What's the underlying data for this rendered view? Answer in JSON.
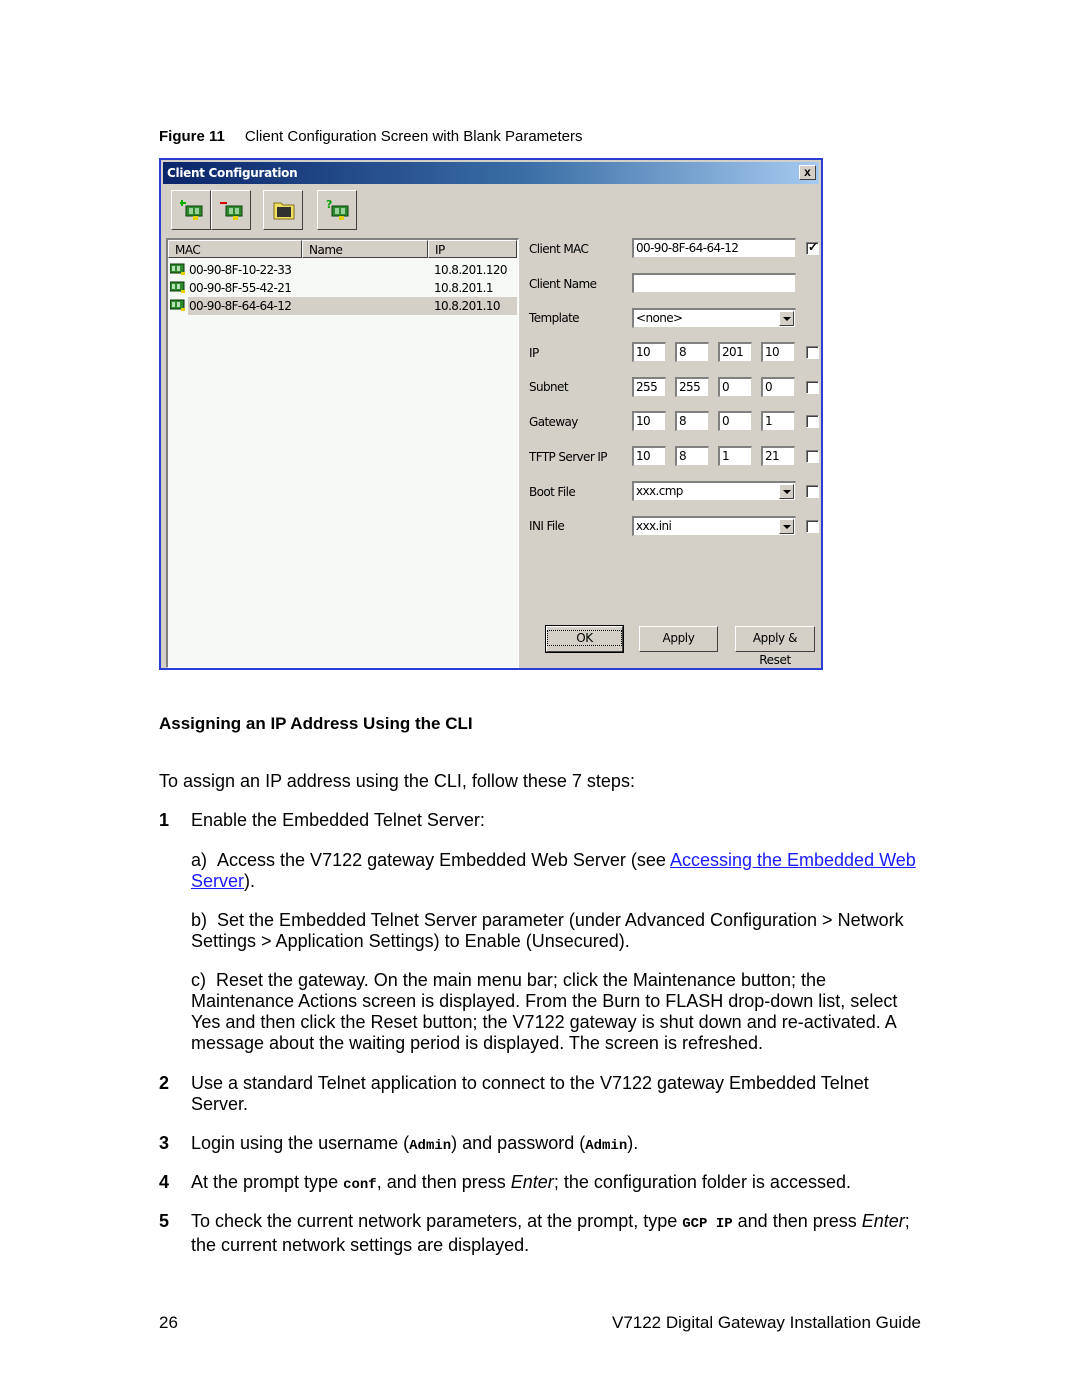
{
  "figure": {
    "label": "Figure 11",
    "caption": "Client Configuration Screen with Blank Parameters"
  },
  "window": {
    "title": "Client Configuration",
    "close_label": "x",
    "toolbar": [
      {
        "icon": "add-client-icon",
        "tooltip": ""
      },
      {
        "icon": "remove-client-icon",
        "tooltip": ""
      },
      {
        "icon": "folder-icon",
        "tooltip": ""
      },
      {
        "icon": "query-client-icon",
        "tooltip": ""
      }
    ],
    "list": {
      "columns": [
        "MAC",
        "Name",
        "IP"
      ],
      "rows": [
        {
          "mac": "00-90-8F-10-22-33",
          "name": "",
          "ip": "10.8.201.120",
          "selected": false
        },
        {
          "mac": "00-90-8F-55-42-21",
          "name": "",
          "ip": "10.8.201.1",
          "selected": false
        },
        {
          "mac": "00-90-8F-64-64-12",
          "name": "",
          "ip": "10.8.201.10",
          "selected": true
        }
      ]
    },
    "form": {
      "client_mac": {
        "label": "Client MAC",
        "value": "00-90-8F-64-64-12",
        "checked": true
      },
      "client_name": {
        "label": "Client Name",
        "value": ""
      },
      "template": {
        "label": "Template",
        "value": "<none>"
      },
      "ip": {
        "label": "IP",
        "octets": [
          "10",
          "8",
          "201",
          "10"
        ],
        "checked": false
      },
      "subnet": {
        "label": "Subnet",
        "octets": [
          "255",
          "255",
          "0",
          "0"
        ],
        "checked": false
      },
      "gateway": {
        "label": "Gateway",
        "octets": [
          "10",
          "8",
          "0",
          "1"
        ],
        "checked": false
      },
      "tftp": {
        "label": "TFTP Server IP",
        "octets": [
          "10",
          "8",
          "1",
          "21"
        ],
        "checked": false
      },
      "boot_file": {
        "label": "Boot File",
        "value": "xxx.cmp",
        "checked": false
      },
      "ini_file": {
        "label": "INI File",
        "value": "xxx.ini",
        "checked": false
      }
    },
    "buttons": {
      "ok": "OK",
      "apply": "Apply",
      "apply_reset": "Apply & Reset"
    }
  },
  "section": {
    "heading": "Assigning an IP Address Using the CLI",
    "intro": "To assign an IP address using the CLI, follow these 7 steps:",
    "step1": {
      "num": "1",
      "text": "Enable the Embedded Telnet Server:",
      "a": {
        "letter": "a)",
        "pre": "Access the V7122 gateway Embedded Web Server (see ",
        "link": "Accessing the Embedded Web Server",
        "post": ")."
      },
      "b": {
        "letter": "b)",
        "text": "Set the Embedded Telnet Server parameter (under Advanced Configuration > Network Settings > Application Settings) to Enable (Unsecured)."
      },
      "c": {
        "letter": "c)",
        "text": "Reset the gateway. On the main menu bar; click the Maintenance button; the Maintenance Actions screen is displayed. From the Burn to FLASH drop-down list, select Yes and then click the Reset button; the V7122 gateway is shut down and re-activated. A message about the waiting period is displayed. The screen is refreshed."
      }
    },
    "step2": {
      "num": "2",
      "text": "Use a standard Telnet application to connect to the V7122 gateway Embedded Telnet Server."
    },
    "step3": {
      "num": "3",
      "pre": "Login using the username (",
      "user": "Admin",
      "mid": ") and password (",
      "pass": "Admin",
      "post": ")."
    },
    "step4": {
      "num": "4",
      "pre": "At the prompt type ",
      "code": "conf",
      "mid": ", and then press ",
      "em": "Enter",
      "post": "; the configuration folder is accessed."
    },
    "step5": {
      "num": "5",
      "pre": "To check the current network parameters, at the prompt, type ",
      "code": "GCP IP",
      "mid": " and then press ",
      "em": "Enter",
      "post": "; the current network settings are displayed."
    }
  },
  "footer": {
    "page_number": "26",
    "doc_title": "V7122 Digital Gateway Installation Guide"
  }
}
